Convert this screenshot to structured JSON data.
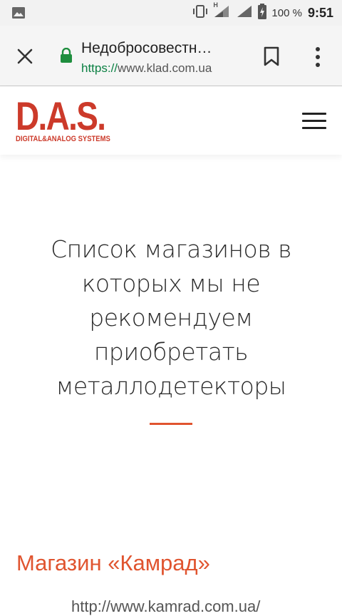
{
  "status_bar": {
    "battery_percent": "100 %",
    "time": "9:51",
    "network_label": "H"
  },
  "browser": {
    "page_title": "Недобросовестн…",
    "url_scheme": "https://",
    "url_host": "www.klad.com.ua",
    "icons": [
      "close-icon",
      "lock-icon",
      "bookmark-icon",
      "more-vert-icon"
    ],
    "secure_color": "#1e8e3e"
  },
  "site": {
    "logo_main": "D.A.S.",
    "logo_sub": "DIGITAL&ANALOG SYSTEMS",
    "brand_color": "#cc3a2a",
    "accent_color": "#e0542f"
  },
  "content": {
    "heading_lines": [
      "Список магазинов в",
      "которых мы не",
      "рекомендуем",
      "приобретать",
      "металлодетекторы"
    ],
    "shop_title": "Магазин «Камрад»",
    "partial_link": "http://www.kamrad.com.ua/"
  }
}
